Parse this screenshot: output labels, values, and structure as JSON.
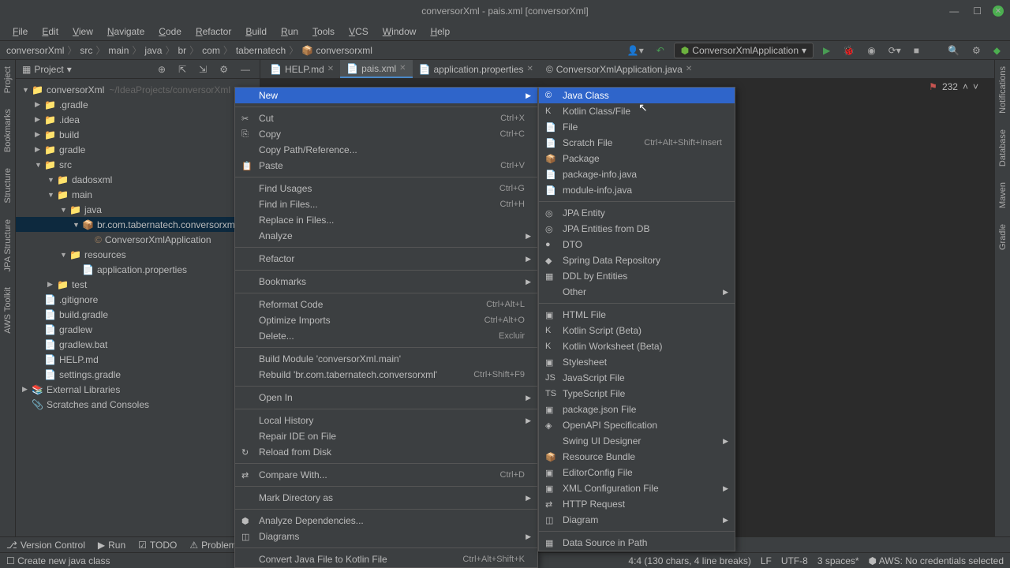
{
  "window": {
    "title": "conversorXml - pais.xml [conversorXml]"
  },
  "menubar": [
    "File",
    "Edit",
    "View",
    "Navigate",
    "Code",
    "Refactor",
    "Build",
    "Run",
    "Tools",
    "VCS",
    "Window",
    "Help"
  ],
  "breadcrumb": [
    "conversorXml",
    "src",
    "main",
    "java",
    "br",
    "com",
    "tabernatech",
    "conversorxml"
  ],
  "runconfig": "ConversorXmlApplication",
  "project_panel": {
    "title": "Project"
  },
  "tree": [
    {
      "l": 0,
      "a": "▼",
      "i": "📁",
      "t": "conversorXml",
      "suf": "~/IdeaProjects/conversorXml"
    },
    {
      "l": 1,
      "a": "▶",
      "i": "📁",
      "t": ".gradle"
    },
    {
      "l": 1,
      "a": "▶",
      "i": "📁",
      "t": ".idea"
    },
    {
      "l": 1,
      "a": "▶",
      "i": "📁",
      "t": "build"
    },
    {
      "l": 1,
      "a": "▶",
      "i": "📁",
      "t": "gradle"
    },
    {
      "l": 1,
      "a": "▼",
      "i": "📁",
      "t": "src"
    },
    {
      "l": 2,
      "a": "▼",
      "i": "📁",
      "t": "dadosxml"
    },
    {
      "l": 2,
      "a": "▼",
      "i": "📁",
      "t": "main"
    },
    {
      "l": 3,
      "a": "▼",
      "i": "📁",
      "t": "java"
    },
    {
      "l": 4,
      "a": "▼",
      "i": "📦",
      "t": "br.com.tabernatech.conversorxml",
      "sel": true
    },
    {
      "l": 5,
      "a": "",
      "i": "©",
      "t": "ConversorXmlApplication"
    },
    {
      "l": 3,
      "a": "▼",
      "i": "📁",
      "t": "resources"
    },
    {
      "l": 4,
      "a": "",
      "i": "📄",
      "t": "application.properties"
    },
    {
      "l": 2,
      "a": "▶",
      "i": "📁",
      "t": "test"
    },
    {
      "l": 1,
      "a": "",
      "i": "📄",
      "t": ".gitignore"
    },
    {
      "l": 1,
      "a": "",
      "i": "📄",
      "t": "build.gradle"
    },
    {
      "l": 1,
      "a": "",
      "i": "📄",
      "t": "gradlew"
    },
    {
      "l": 1,
      "a": "",
      "i": "📄",
      "t": "gradlew.bat"
    },
    {
      "l": 1,
      "a": "",
      "i": "📄",
      "t": "HELP.md"
    },
    {
      "l": 1,
      "a": "",
      "i": "📄",
      "t": "settings.gradle"
    },
    {
      "l": 0,
      "a": "▶",
      "i": "📚",
      "t": "External Libraries"
    },
    {
      "l": 0,
      "a": "",
      "i": "📎",
      "t": "Scratches and Consoles"
    }
  ],
  "tabs": [
    {
      "label": "HELP.md",
      "icon": "📄"
    },
    {
      "label": "pais.xml",
      "icon": "📄",
      "active": true
    },
    {
      "label": "application.properties",
      "icon": "📄"
    },
    {
      "label": "ConversorXmlApplication.java",
      "icon": "©"
    }
  ],
  "editor_info": {
    "nav_count": "232"
  },
  "context_menu1": [
    {
      "t": "New",
      "sub": true,
      "hl": true
    },
    {
      "sep": true
    },
    {
      "t": "Cut",
      "sc": "Ctrl+X",
      "i": "✂"
    },
    {
      "t": "Copy",
      "sc": "Ctrl+C",
      "i": "⎘"
    },
    {
      "t": "Copy Path/Reference..."
    },
    {
      "t": "Paste",
      "sc": "Ctrl+V",
      "i": "📋"
    },
    {
      "sep": true
    },
    {
      "t": "Find Usages",
      "sc": "Ctrl+G"
    },
    {
      "t": "Find in Files...",
      "sc": "Ctrl+H"
    },
    {
      "t": "Replace in Files..."
    },
    {
      "t": "Analyze",
      "sub": true
    },
    {
      "sep": true
    },
    {
      "t": "Refactor",
      "sub": true
    },
    {
      "sep": true
    },
    {
      "t": "Bookmarks",
      "sub": true
    },
    {
      "sep": true
    },
    {
      "t": "Reformat Code",
      "sc": "Ctrl+Alt+L"
    },
    {
      "t": "Optimize Imports",
      "sc": "Ctrl+Alt+O"
    },
    {
      "t": "Delete...",
      "sc": "Excluir"
    },
    {
      "sep": true
    },
    {
      "t": "Build Module 'conversorXml.main'"
    },
    {
      "t": "Rebuild 'br.com.tabernatech.conversorxml'",
      "sc": "Ctrl+Shift+F9"
    },
    {
      "sep": true
    },
    {
      "t": "Open In",
      "sub": true
    },
    {
      "sep": true
    },
    {
      "t": "Local History",
      "sub": true
    },
    {
      "t": "Repair IDE on File"
    },
    {
      "t": "Reload from Disk",
      "i": "↻"
    },
    {
      "sep": true
    },
    {
      "t": "Compare With...",
      "sc": "Ctrl+D",
      "i": "⇄"
    },
    {
      "sep": true
    },
    {
      "t": "Mark Directory as",
      "sub": true
    },
    {
      "sep": true
    },
    {
      "t": "Analyze Dependencies...",
      "i": "⬢"
    },
    {
      "t": "Diagrams",
      "sub": true,
      "i": "◫"
    },
    {
      "sep": true
    },
    {
      "t": "Convert Java File to Kotlin File",
      "sc": "Ctrl+Alt+Shift+K"
    }
  ],
  "context_menu2": [
    {
      "t": "Java Class",
      "i": "©",
      "hl": true
    },
    {
      "t": "Kotlin Class/File",
      "i": "K"
    },
    {
      "t": "File",
      "i": "📄"
    },
    {
      "t": "Scratch File",
      "sc": "Ctrl+Alt+Shift+Insert",
      "i": "📄"
    },
    {
      "t": "Package",
      "i": "📦"
    },
    {
      "t": "package-info.java",
      "i": "📄"
    },
    {
      "t": "module-info.java",
      "i": "📄"
    },
    {
      "sep": true
    },
    {
      "t": "JPA Entity",
      "i": "◎"
    },
    {
      "t": "JPA Entities from DB",
      "i": "◎"
    },
    {
      "t": "DTO",
      "i": "●"
    },
    {
      "t": "Spring Data Repository",
      "i": "◆"
    },
    {
      "t": "DDL by Entities",
      "i": "▦"
    },
    {
      "t": "Other",
      "sub": true
    },
    {
      "sep": true
    },
    {
      "t": "HTML File",
      "i": "▣"
    },
    {
      "t": "Kotlin Script (Beta)",
      "i": "K"
    },
    {
      "t": "Kotlin Worksheet (Beta)",
      "i": "K"
    },
    {
      "t": "Stylesheet",
      "i": "▣"
    },
    {
      "t": "JavaScript File",
      "i": "JS"
    },
    {
      "t": "TypeScript File",
      "i": "TS"
    },
    {
      "t": "package.json File",
      "i": "▣"
    },
    {
      "t": "OpenAPI Specification",
      "i": "◈"
    },
    {
      "t": "Swing UI Designer",
      "sub": true
    },
    {
      "t": "Resource Bundle",
      "i": "📦"
    },
    {
      "t": "EditorConfig File",
      "i": "▣"
    },
    {
      "t": "XML Configuration File",
      "sub": true,
      "i": "▣"
    },
    {
      "t": "HTTP Request",
      "i": "⇄"
    },
    {
      "t": "Diagram",
      "sub": true,
      "i": "◫"
    },
    {
      "sep": true
    },
    {
      "t": "Data Source in Path",
      "i": "▦"
    }
  ],
  "bottom_bar": {
    "version_control": "Version Control",
    "run": "Run",
    "todo": "TODO",
    "problems": "Problems"
  },
  "status": {
    "hint": "Create new java class",
    "pos": "4:4 (130 chars, 4 line breaks)",
    "lf": "LF",
    "enc": "UTF-8",
    "indent": "3 spaces*",
    "aws": "AWS: No credentials selected"
  },
  "gutters": {
    "left": [
      "Project",
      "Bookmarks",
      "Structure",
      "JPA Structure",
      "AWS Toolkit"
    ],
    "right": [
      "Notifications",
      "Database",
      "Maven",
      "Gradle"
    ]
  }
}
